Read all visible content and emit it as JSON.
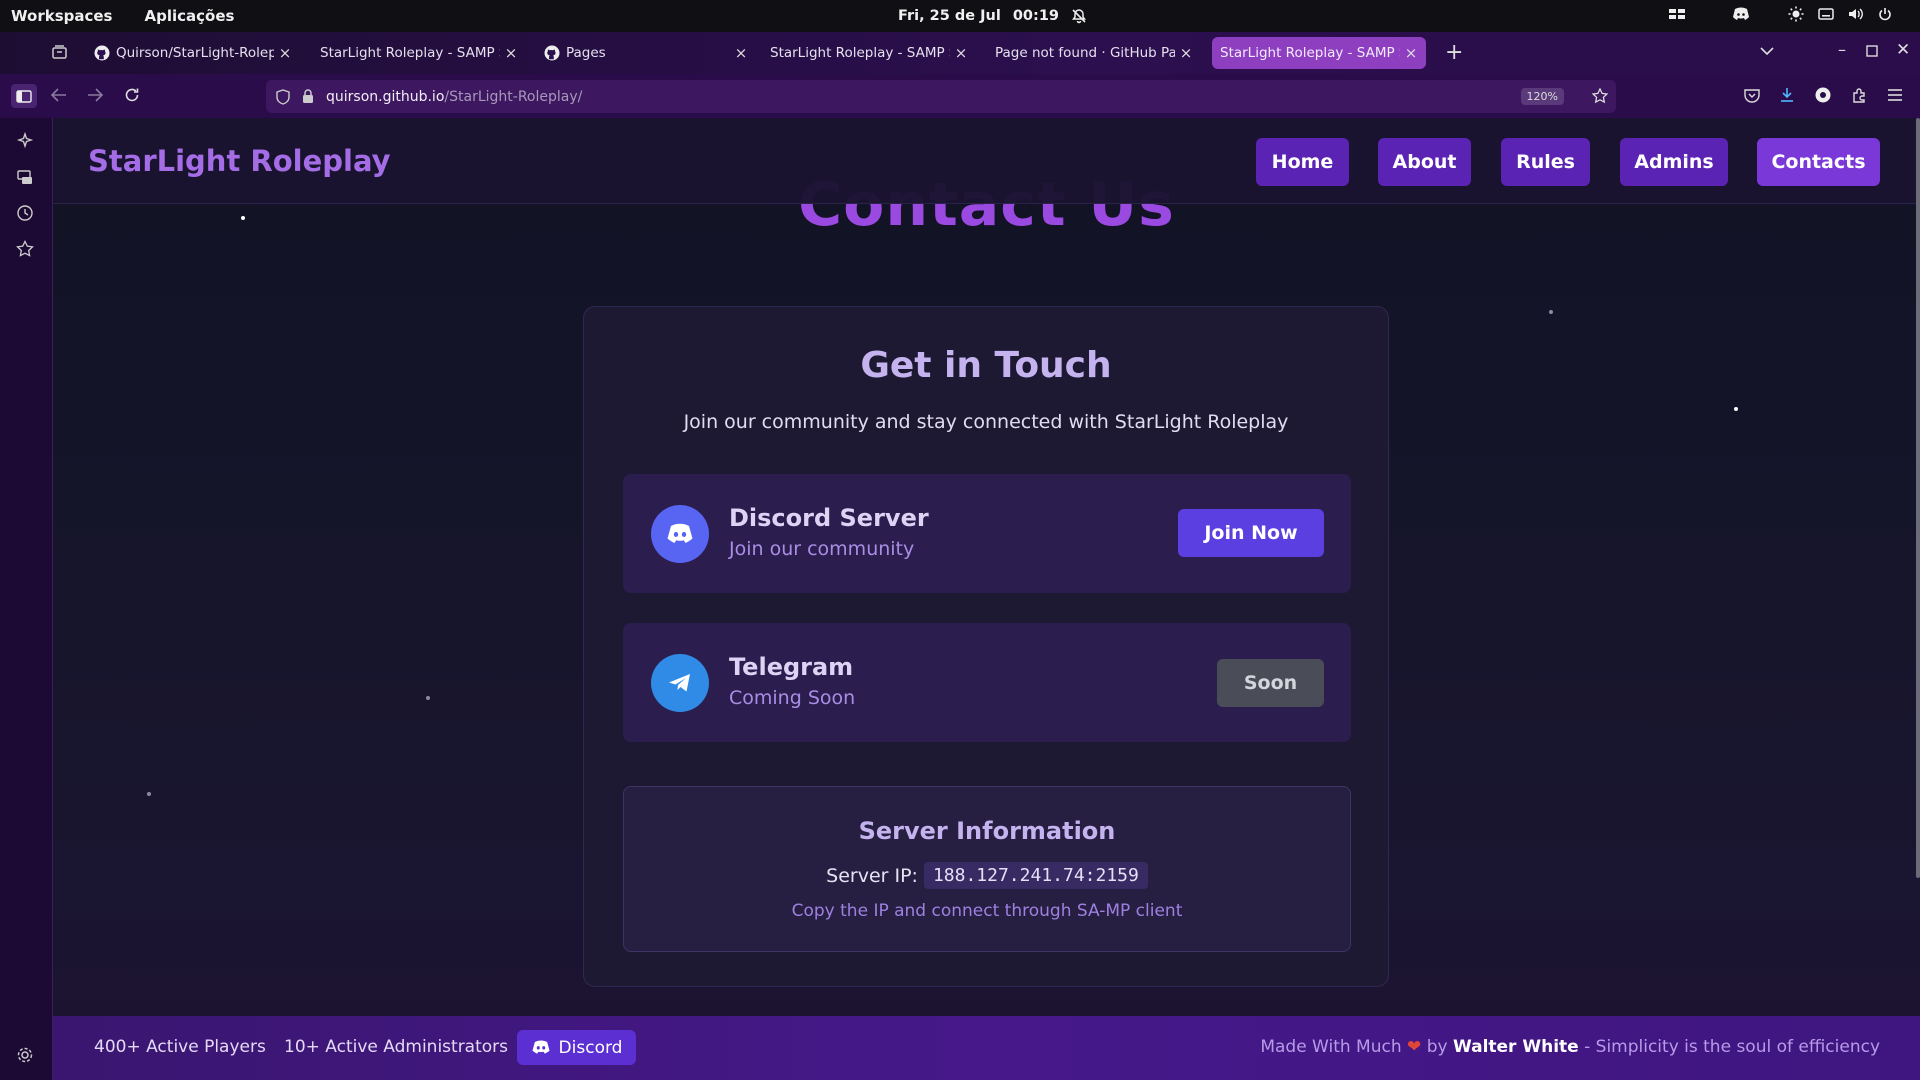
{
  "os": {
    "workspaces": "Workspaces",
    "apps": "Aplicações",
    "date": "Fri, 25 de Jul",
    "time": "00:19"
  },
  "tabs": [
    {
      "title": "Quirson/StarLight-Roleplay",
      "icon": "github-icon",
      "active": false
    },
    {
      "title": "StarLight Roleplay - SAMP Server",
      "icon": "",
      "active": false
    },
    {
      "title": "Pages",
      "icon": "github-icon",
      "active": false
    },
    {
      "title": "StarLight Roleplay - SAMP Server",
      "icon": "",
      "active": false
    },
    {
      "title": "Page not found · GitHub Pages",
      "icon": "",
      "active": false
    },
    {
      "title": "StarLight Roleplay - SAMP Server",
      "icon": "",
      "active": true
    }
  ],
  "browser": {
    "url_host": "quirson.github.io",
    "url_path": "/StarLight-Roleplay/",
    "zoom": "120%"
  },
  "site": {
    "brand": "StarLight Roleplay",
    "nav": [
      "Home",
      "About",
      "Rules",
      "Admins",
      "Contacts"
    ],
    "active_nav": "Contacts",
    "section_title": "Contact Us"
  },
  "contact": {
    "title": "Get in Touch",
    "subtitle": "Join our community and stay connected with StarLight Roleplay",
    "discord": {
      "name": "Discord Server",
      "desc": "Join our community",
      "button": "Join Now"
    },
    "telegram": {
      "name": "Telegram",
      "desc": "Coming Soon",
      "button": "Soon"
    },
    "server": {
      "title": "Server Information",
      "ip_label": "Server IP:",
      "ip": "188.127.241.74:2159",
      "note": "Copy the IP and connect through SA-MP client"
    }
  },
  "footer": {
    "players": "400+ Active Players",
    "admins": "10+ Active Administrators",
    "discord": "Discord",
    "made_with": "Made With Much",
    "by": "by",
    "author": "Walter White",
    "tagline": "- Simplicity is the soul of efficiency"
  },
  "colors": {
    "accent": "#7b38d8",
    "discord": "#5865f2",
    "telegram": "#2f8be6"
  }
}
